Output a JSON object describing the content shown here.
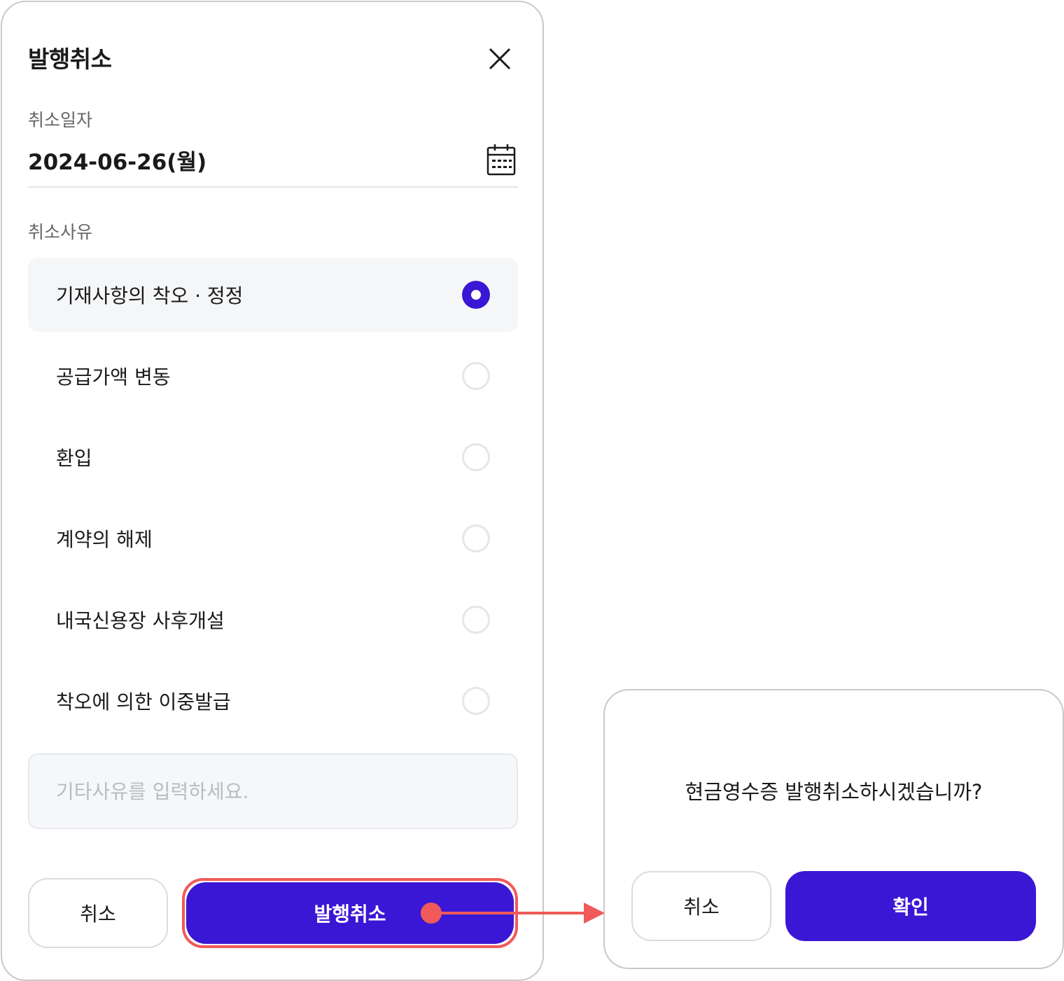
{
  "sheet": {
    "title": "발행취소",
    "close_icon": "close-icon",
    "date_label": "취소일자",
    "date_value": "2024-06-26(월)",
    "calendar_icon": "calendar-icon",
    "reason_label": "취소사유",
    "reasons": [
      {
        "label": "기재사항의 착오 · 정정",
        "selected": true
      },
      {
        "label": "공급가액 변동",
        "selected": false
      },
      {
        "label": "환입",
        "selected": false
      },
      {
        "label": "계약의 해제",
        "selected": false
      },
      {
        "label": "내국신용장 사후개설",
        "selected": false
      },
      {
        "label": "착오에 의한 이중발급",
        "selected": false
      }
    ],
    "etc_placeholder": "기타사유를 입력하세요.",
    "cancel_label": "취소",
    "submit_label": "발행취소"
  },
  "dialog": {
    "message": "현금영수증 발행취소하시겠습니까?",
    "cancel_label": "취소",
    "confirm_label": "확인"
  },
  "colors": {
    "primary": "#3a17d4",
    "annotation": "#f05a5a",
    "selected_row_bg": "#f5f6f8"
  }
}
